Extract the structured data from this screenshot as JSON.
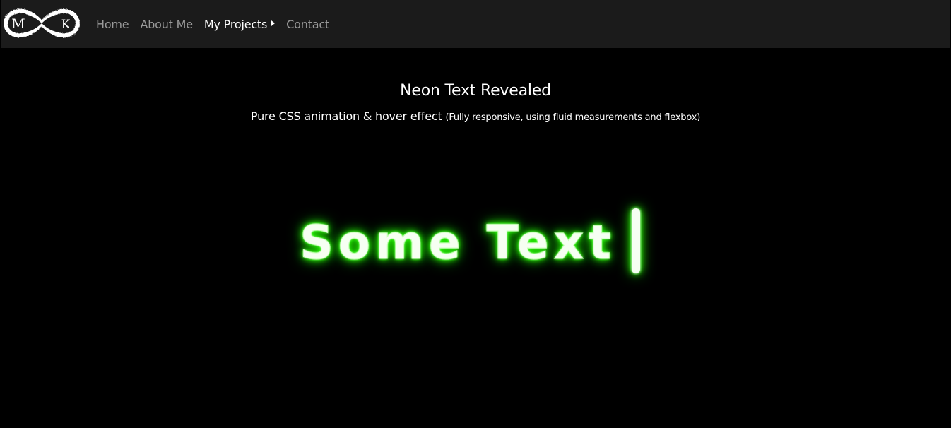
{
  "logo": {
    "letter_left": "M",
    "letter_right": "K"
  },
  "nav": {
    "items": [
      {
        "label": "Home"
      },
      {
        "label": "About Me"
      },
      {
        "label": "My Projects"
      },
      {
        "label": "Contact"
      }
    ],
    "active": "My Projects"
  },
  "main": {
    "title": "Neon Text Revealed",
    "subtitle": "Pure CSS animation & hover effect",
    "subtitle_note": "(Fully responsive, using fluid measurements and flexbox)",
    "neon_text": "Some Text"
  },
  "colors": {
    "background": "#000000",
    "navbar": "#1b1b1b",
    "nav_text": "#9a9a9a",
    "nav_active": "#ffffff",
    "neon_glow": "#2cff0a"
  }
}
